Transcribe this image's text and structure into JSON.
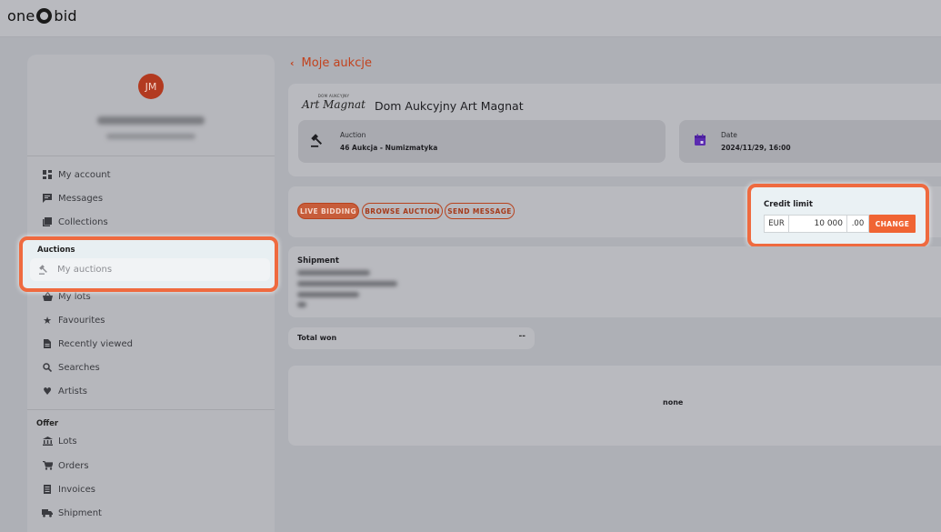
{
  "brand": {
    "left": "one",
    "right": "bid"
  },
  "user": {
    "initials": "JM"
  },
  "sidebar": {
    "account_items": [
      {
        "label": "My account",
        "icon": "dashboard-icon"
      },
      {
        "label": "Messages",
        "icon": "message-icon"
      },
      {
        "label": "Collections",
        "icon": "collections-icon"
      }
    ],
    "auctions_heading": "Auctions",
    "auctions_item": {
      "label": "My auctions",
      "icon": "gavel-icon"
    },
    "lots_items": [
      {
        "label": "My lots",
        "icon": "basket-icon"
      },
      {
        "label": "Favourites",
        "icon": "star-icon"
      },
      {
        "label": "Recently viewed",
        "icon": "document-icon"
      },
      {
        "label": "Searches",
        "icon": "search-icon"
      },
      {
        "label": "Artists",
        "icon": "heart-icon"
      }
    ],
    "offer_heading": "Offer",
    "offer_items": [
      {
        "label": "Lots",
        "icon": "bank-icon"
      },
      {
        "label": "Orders",
        "icon": "cart-icon"
      },
      {
        "label": "Invoices",
        "icon": "invoice-icon"
      },
      {
        "label": "Shipment",
        "icon": "truck-icon"
      }
    ]
  },
  "main": {
    "back_label": "Moje aukcje",
    "house": {
      "logo_small": "DOM AUKCYJNY",
      "logo_script": "Art Magnat",
      "name": "Dom Aukcyjny Art Magnat"
    },
    "auction": {
      "label": "Auction",
      "value": "46 Aukcja - Numizmatyka"
    },
    "date": {
      "label": "Date",
      "value": "2024/11/29, 16:00"
    },
    "actions": {
      "live": "LIVE BIDDING",
      "browse": "BROWSE AUCTION",
      "message": "SEND MESSAGE"
    },
    "credit": {
      "title": "Credit limit",
      "currency": "EUR",
      "amount": "10 000",
      "decimals": ".00",
      "button": "CHANGE"
    },
    "shipment_title": "Shipment",
    "total": {
      "label": "Total won",
      "value": "--"
    },
    "list_empty": "none"
  },
  "colors": {
    "accent": "#f06433",
    "highlight_border": "#ef6a3f",
    "avatar": "#b23a20",
    "link": "#c2421d"
  }
}
